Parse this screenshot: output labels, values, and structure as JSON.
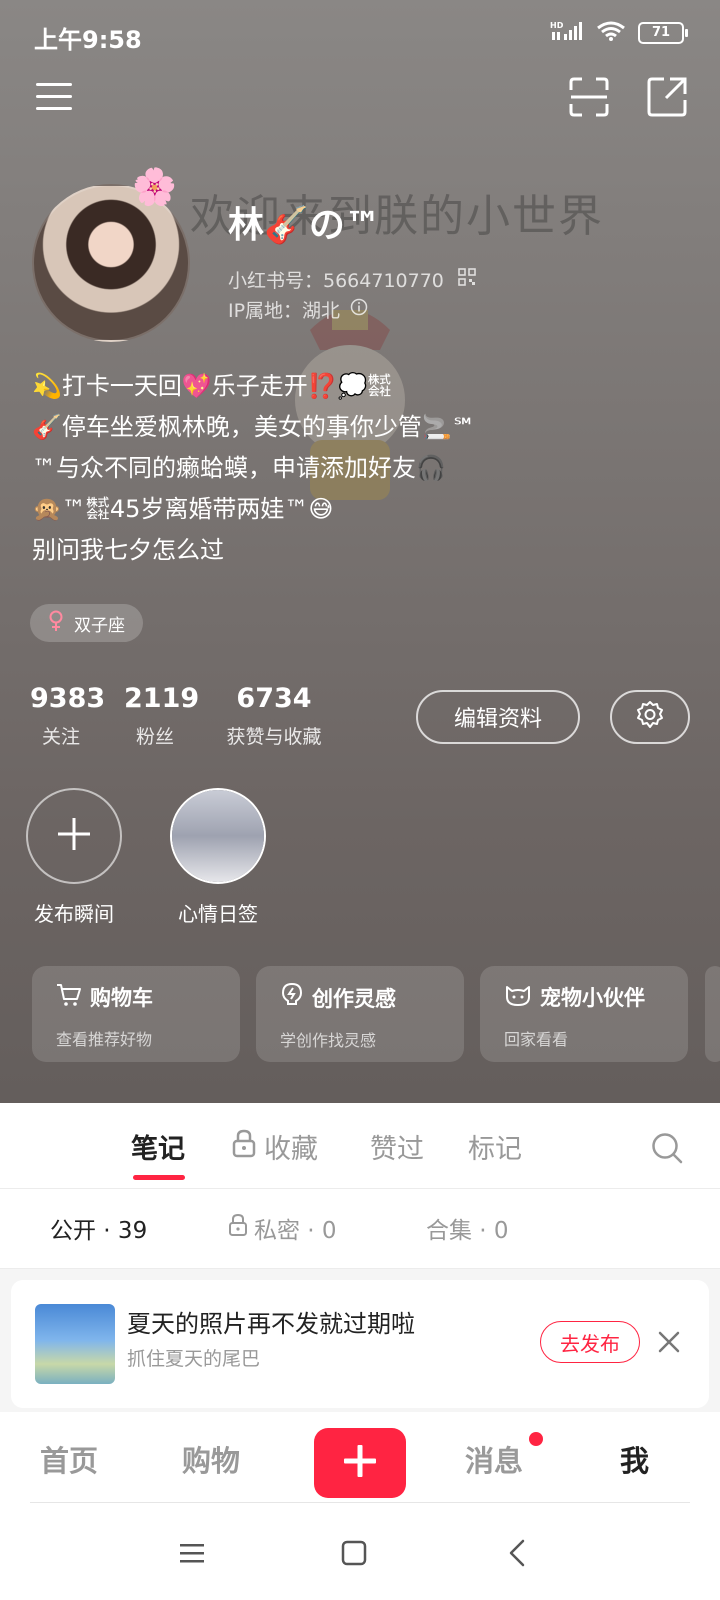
{
  "status_bar": {
    "time": "上午9:58",
    "network": "HD",
    "battery": "71"
  },
  "profile": {
    "nickname": "林🎸の™",
    "id_line": "小红书号：5664710770",
    "ip_line": "IP属地：湖北",
    "bg_text": "欢迎来到朕的小世界",
    "bio": [
      "💫打卡一天回💖乐子走开⁉️💭㍿",
      "🎸停车坐爱枫林晚，美女的事你少管🚬℠",
      "™与众不同的癞蛤蟆，申请添加好友🎧",
      "🙊™㍿45岁离婚带两娃™😅",
      "别问我七夕怎么过"
    ],
    "tag": "双子座"
  },
  "stats": [
    {
      "value": "9383",
      "label": "关注"
    },
    {
      "value": "2119",
      "label": "粉丝"
    },
    {
      "value": "6734",
      "label": "获赞与收藏"
    }
  ],
  "buttons": {
    "edit_profile": "编辑资料"
  },
  "moments": [
    {
      "label": "发布瞬间"
    },
    {
      "label": "心情日签"
    }
  ],
  "feature_cards": [
    {
      "title": "购物车",
      "subtitle": "查看推荐好物"
    },
    {
      "title": "创作灵感",
      "subtitle": "学创作找灵感"
    },
    {
      "title": "宠物小伙伴",
      "subtitle": "回家看看"
    }
  ],
  "tabs": [
    {
      "label": "笔记",
      "active": true
    },
    {
      "label": "收藏",
      "locked": true
    },
    {
      "label": "赞过"
    },
    {
      "label": "标记"
    }
  ],
  "subtabs": [
    {
      "label": "公开 · 39",
      "active": true
    },
    {
      "label": "私密 · 0",
      "locked": true
    },
    {
      "label": "合集 · 0"
    }
  ],
  "promo": {
    "title": "夏天的照片再不发就过期啦",
    "subtitle": "抓住夏天的尾巴",
    "button": "去发布"
  },
  "bottom_nav": [
    {
      "label": "首页"
    },
    {
      "label": "购物"
    },
    {
      "label": "消息",
      "badge": true
    },
    {
      "label": "我",
      "active": true
    }
  ],
  "colors": {
    "accent": "#ff2442",
    "hero_bg": "#6f6967"
  }
}
